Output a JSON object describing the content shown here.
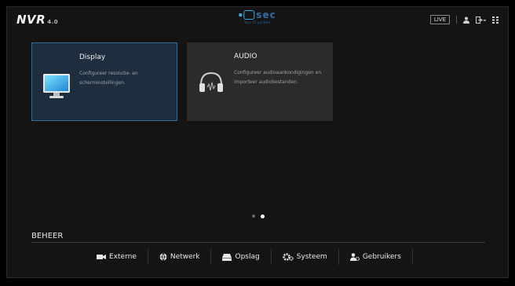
{
  "header": {
    "logo_text": "NVR",
    "logo_version": "4.0",
    "brand_text": "sec",
    "brand_tagline": "Your IT partner",
    "live_label": "LIVE"
  },
  "cards": [
    {
      "title": "Display",
      "description": "Configureer resolutie- en scherminstellingen.",
      "icon": "monitor-icon",
      "selected": true
    },
    {
      "title": "AUDIO",
      "description": "Configureer audioaankondigingen en importeer audiobestanden.",
      "icon": "headphones-icon",
      "selected": false
    }
  ],
  "pager": {
    "pages": 2,
    "current": 2
  },
  "footer": {
    "section_title": "BEHEER",
    "nav": [
      {
        "label": "Externe",
        "icon": "camera-icon"
      },
      {
        "label": "Netwerk",
        "icon": "globe-icon"
      },
      {
        "label": "Opslag",
        "icon": "storage-icon"
      },
      {
        "label": "Systeem",
        "icon": "gears-icon"
      },
      {
        "label": "Gebruikers",
        "icon": "user-settings-icon"
      }
    ]
  },
  "colors": {
    "accent": "#2d6ea0",
    "selected_card_bg": "#1f2e3e",
    "card_bg": "#2b2b2b",
    "brand_blue": "#3aa6e8"
  }
}
